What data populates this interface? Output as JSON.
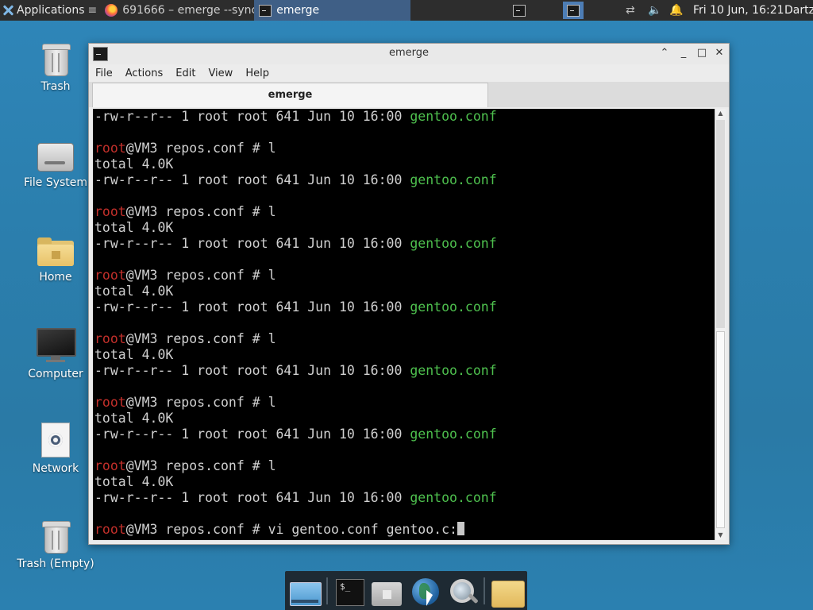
{
  "panel": {
    "applications_label": "Applications",
    "tasks": [
      {
        "label": "691666 – emerge --sync..."
      },
      {
        "label": "emerge"
      }
    ],
    "clock": "Fri 10 Jun, 16:21",
    "user": "Dartz"
  },
  "desktop_icons": [
    {
      "label": "Trash"
    },
    {
      "label": "File System"
    },
    {
      "label": "Home"
    },
    {
      "label": "Computer"
    },
    {
      "label": "Network"
    },
    {
      "label": "Trash (Empty)"
    }
  ],
  "window": {
    "title": "emerge",
    "menu": [
      "File",
      "Actions",
      "Edit",
      "View",
      "Help"
    ],
    "tab_label": "emerge"
  },
  "terminal": {
    "prompt_user": "root",
    "prompt_rest": "@VM3 repos.conf # ",
    "command_l": "l",
    "total_line": "total 4.0K",
    "ls_prefix": "-rw-r--r-- 1 root root 641 Jun 10 16:00 ",
    "ls_file": "gentoo.conf",
    "last_command": "vi gentoo.conf gentoo.c:"
  },
  "colors": {
    "prompt_user": "#c4302b",
    "file_name": "#4ec04e",
    "terminal_bg": "#000000",
    "panel_bg": "#2d2d2d"
  }
}
